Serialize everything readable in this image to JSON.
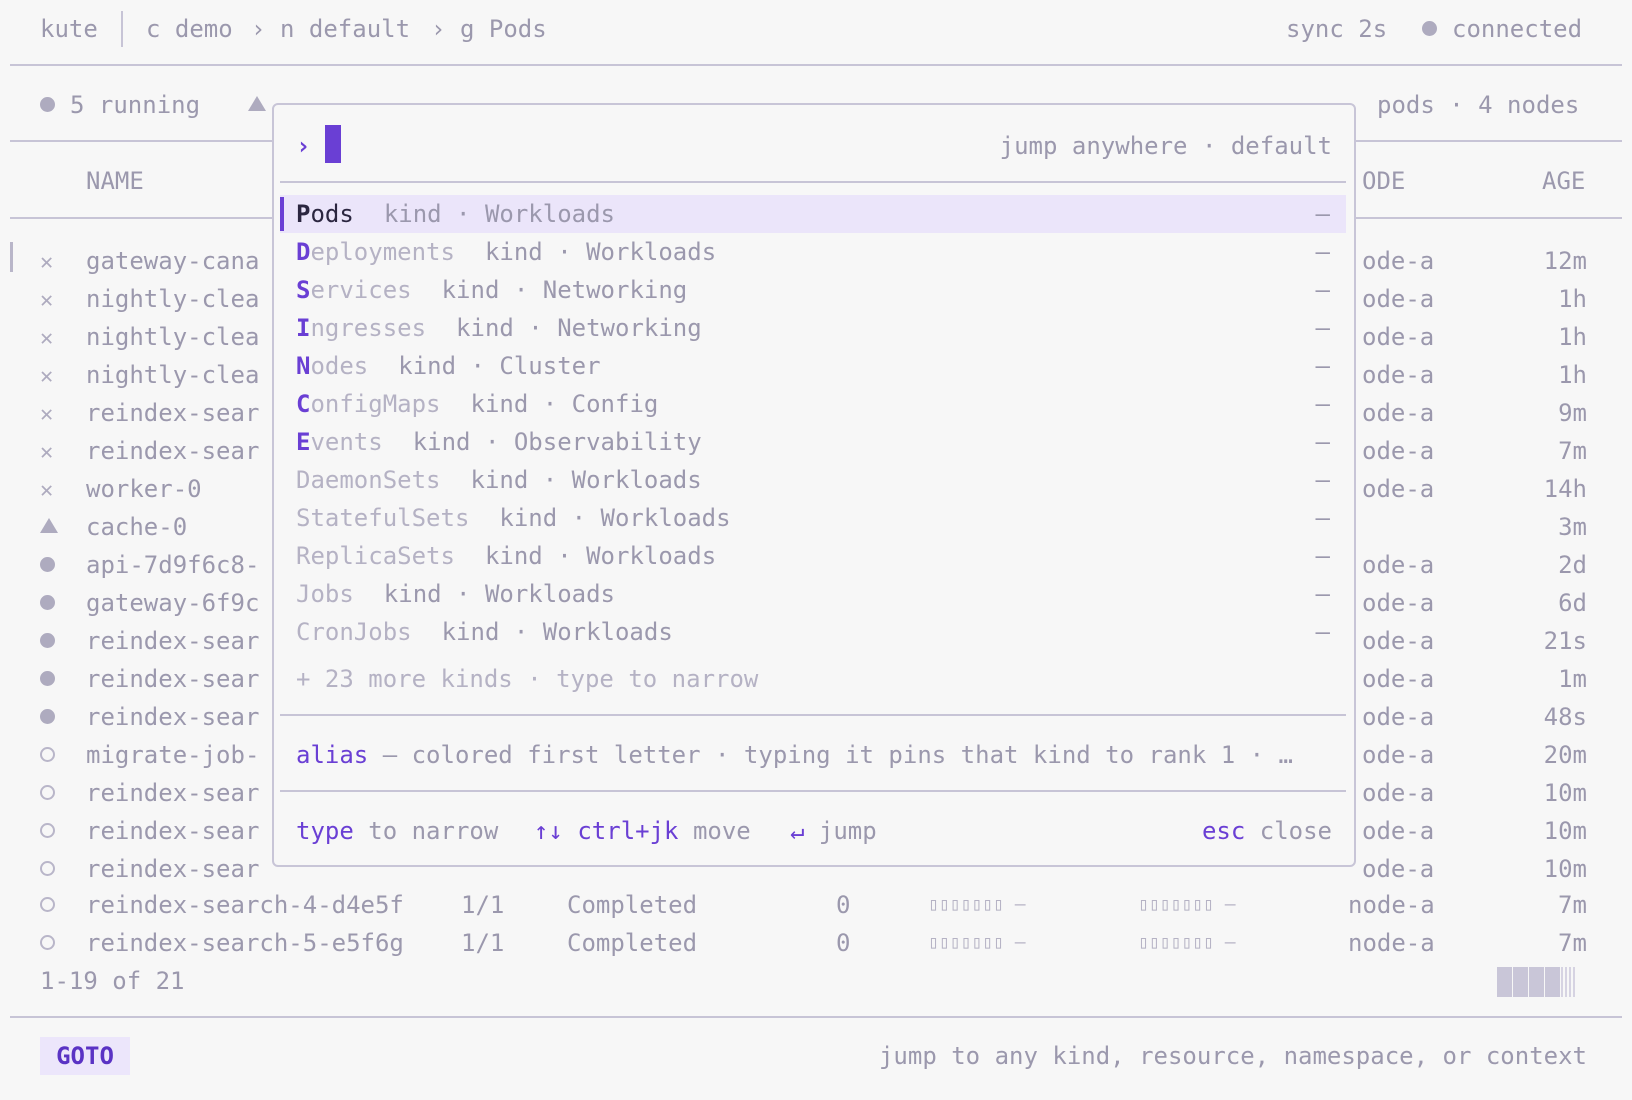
{
  "header": {
    "app": "kute",
    "crumbs": [
      "c demo",
      "n default",
      "g Pods"
    ],
    "sep": "›",
    "sync": "sync 2s",
    "status": "connected"
  },
  "summary": {
    "running": "5 running",
    "right": "pods · 4 nodes"
  },
  "table": {
    "col_name": "NAME",
    "col_node_partial": "ODE",
    "col_age": "AGE",
    "rows": [
      {
        "status": "x",
        "name": "gateway-cana",
        "node": "ode-a",
        "age": "12m"
      },
      {
        "status": "x",
        "name": "nightly-clea",
        "node": "ode-a",
        "age": "1h"
      },
      {
        "status": "x",
        "name": "nightly-clea",
        "node": "ode-a",
        "age": "1h"
      },
      {
        "status": "x",
        "name": "nightly-clea",
        "node": "ode-a",
        "age": "1h"
      },
      {
        "status": "x",
        "name": "reindex-sear",
        "node": "ode-a",
        "age": "9m"
      },
      {
        "status": "x",
        "name": "reindex-sear",
        "node": "ode-a",
        "age": "7m"
      },
      {
        "status": "x",
        "name": "worker-0",
        "node": "ode-a",
        "age": "14h"
      },
      {
        "status": "tri",
        "name": "cache-0",
        "node": "",
        "age": "3m"
      },
      {
        "status": "dot",
        "name": "api-7d9f6c8-",
        "node": "ode-a",
        "age": "2d"
      },
      {
        "status": "dot",
        "name": "gateway-6f9c",
        "node": "ode-a",
        "age": "6d"
      },
      {
        "status": "dot",
        "name": "reindex-sear",
        "node": "ode-a",
        "age": "21s"
      },
      {
        "status": "dot",
        "name": "reindex-sear",
        "node": "ode-a",
        "age": "1m"
      },
      {
        "status": "dot",
        "name": "reindex-sear",
        "node": "ode-a",
        "age": "48s"
      },
      {
        "status": "ring",
        "name": "migrate-job-",
        "node": "ode-a",
        "age": "20m"
      },
      {
        "status": "ring",
        "name": "reindex-sear",
        "node": "ode-a",
        "age": "10m"
      },
      {
        "status": "ring",
        "name": "reindex-sear",
        "node": "ode-a",
        "age": "10m"
      },
      {
        "status": "ring",
        "name": "reindex-sear",
        "node": "ode-a",
        "age": "10m"
      }
    ],
    "full_rows": [
      {
        "name": "reindex-search-4-d4e5f",
        "ready": "1/1",
        "status": "Completed",
        "restarts": "0",
        "cpu": "▯▯▯▯▯▯▯ –",
        "mem": "▯▯▯▯▯▯▯ –",
        "node": "node-a",
        "age": "7m"
      },
      {
        "name": "reindex-search-5-e5f6g",
        "ready": "1/1",
        "status": "Completed",
        "restarts": "0",
        "cpu": "▯▯▯▯▯▯▯ –",
        "mem": "▯▯▯▯▯▯▯ –",
        "node": "node-a",
        "age": "7m"
      }
    ],
    "pagination": "1-19 of 21"
  },
  "palette": {
    "prompt": "›",
    "hint": "jump anywhere · default",
    "items": [
      {
        "first": "P",
        "rest": "ods",
        "meta": "kind · Workloads",
        "trail": "–",
        "alias": true
      },
      {
        "first": "D",
        "rest": "eployments",
        "meta": "kind · Workloads",
        "trail": "–",
        "alias": true
      },
      {
        "first": "S",
        "rest": "ervices",
        "meta": "kind · Networking",
        "trail": "–",
        "alias": true
      },
      {
        "first": "I",
        "rest": "ngresses",
        "meta": "kind · Networking",
        "trail": "–",
        "alias": true
      },
      {
        "first": "N",
        "rest": "odes",
        "meta": "kind · Cluster",
        "trail": "–",
        "alias": true
      },
      {
        "first": "C",
        "rest": "onfigMaps",
        "meta": "kind · Config",
        "trail": "–",
        "alias": true
      },
      {
        "first": "E",
        "rest": "vents",
        "meta": "kind · Observability",
        "trail": "–",
        "alias": true
      },
      {
        "first": "",
        "rest": "DaemonSets",
        "meta": "kind · Workloads",
        "trail": "–",
        "alias": false
      },
      {
        "first": "",
        "rest": "StatefulSets",
        "meta": "kind · Workloads",
        "trail": "–",
        "alias": false
      },
      {
        "first": "",
        "rest": "ReplicaSets",
        "meta": "kind · Workloads",
        "trail": "–",
        "alias": false
      },
      {
        "first": "",
        "rest": "Jobs",
        "meta": "kind · Workloads",
        "trail": "–",
        "alias": false
      },
      {
        "first": "",
        "rest": "CronJobs",
        "meta": "kind · Workloads",
        "trail": "–",
        "alias": false
      }
    ],
    "more": "+ 23 more kinds · type to narrow",
    "legend_key": "alias",
    "legend_text": " — colored first letter · typing it pins that kind to rank 1 · …",
    "help": {
      "type_key": "type",
      "type_text": " to narrow",
      "move_key": "↑↓ ctrl+jk",
      "move_text": " move",
      "jump_key": "↵",
      "jump_text": " jump",
      "esc_key": "esc",
      "esc_text": " close"
    }
  },
  "footer": {
    "mode": "GOTO",
    "hint": "jump to any kind, resource, namespace, or context"
  },
  "colors": {
    "accent": "#6a3fd4",
    "muted": "#9b98ad",
    "bg": "#f7f7f7",
    "selection": "#ebe5fa"
  }
}
